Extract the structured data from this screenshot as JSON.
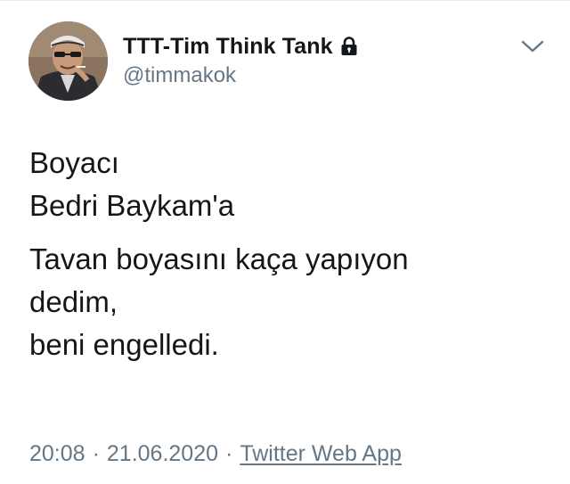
{
  "tweet": {
    "author": {
      "display_name": "TTT-Tim Think Tank",
      "handle": "@timmakok",
      "protected_icon": "lock-icon",
      "avatar": "avatar-photo"
    },
    "menu_icon": "chevron-down-icon",
    "body": {
      "lines_block1": [
        "Boyacı",
        "Bedri Baykam'a"
      ],
      "lines_block2": [
        "Tavan boyasını kaça yapıyon",
        "dedim,",
        "beni engelledi."
      ]
    },
    "meta": {
      "time": "20:08",
      "date": "21.06.2020",
      "separator": "·",
      "source": "Twitter Web App"
    }
  },
  "colors": {
    "text_primary": "#14171a",
    "text_secondary": "#657786",
    "background": "#ffffff"
  }
}
